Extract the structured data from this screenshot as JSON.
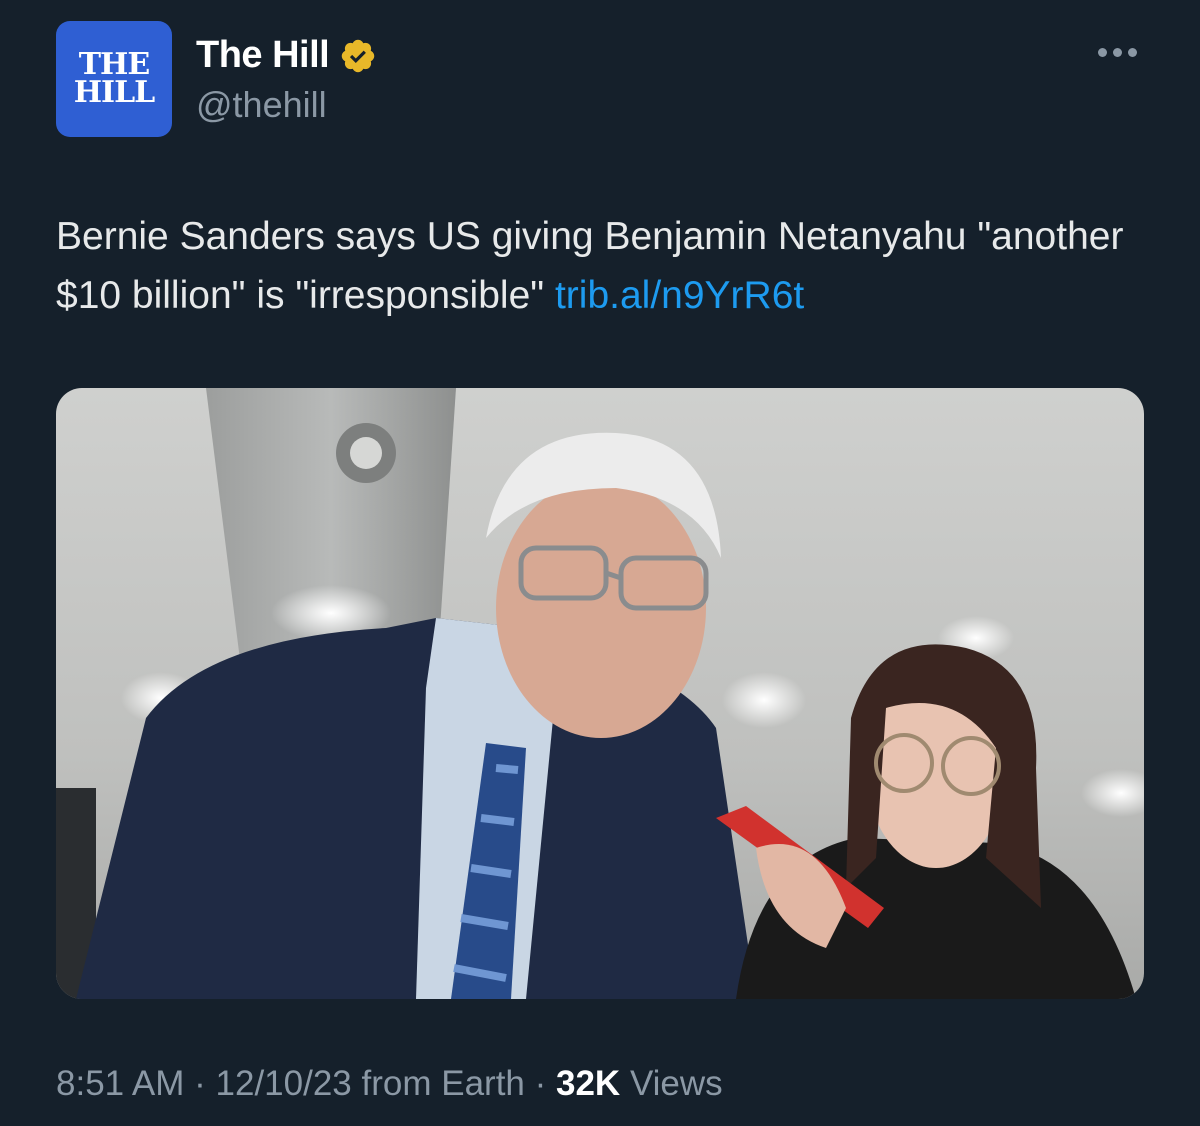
{
  "account": {
    "avatar_line1": "THE",
    "avatar_line2": "HILL",
    "display_name": "The Hill",
    "handle": "@thehill",
    "verified_icon": "gold-verified-badge-icon",
    "brand_color": "#2f5fd3",
    "verified_color": "#e8b829"
  },
  "more_icon": "ellipsis-icon",
  "tweet": {
    "text": "Bernie Sanders says US giving Benjamin Netanyahu \"another $10 billion\" is \"irresponsible\" ",
    "link": "trib.al/n9YrR6t"
  },
  "media": {
    "type": "photo"
  },
  "meta": {
    "time": "8:51 AM",
    "sep1": " · ",
    "date": "12/10/23",
    "source": " from Earth",
    "sep2": " · ",
    "views_count": "32K",
    "views_label": " Views"
  },
  "colors": {
    "background": "#15202b",
    "link": "#1d9bf0",
    "secondary_text": "#8b98a5"
  }
}
